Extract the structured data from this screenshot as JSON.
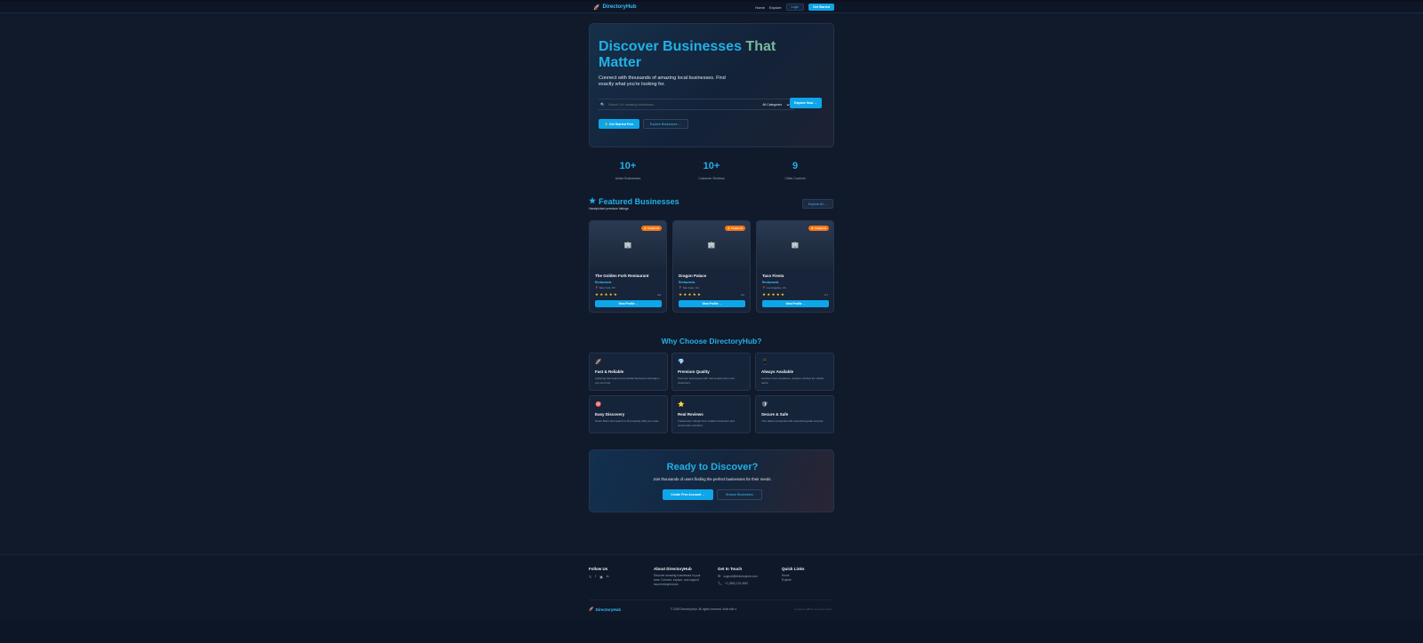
{
  "nav": {
    "logo_text": "DirectoryHub",
    "home": "Home",
    "explore": "Explore",
    "login": "Login",
    "get_started": "Get Started"
  },
  "hero": {
    "title_main": "Discover Businesses ",
    "title_accent": "That",
    "title_end": "Matter",
    "subtitle": "Connect with thousands of amazing local businesses. Find exactly what you're looking for.",
    "search_placeholder": "Search 10+ amazing businesses...",
    "category_selected": "All Categories",
    "explore_now": "Explore Now →",
    "get_started_free": "⚡ Get Started Free",
    "explore_businesses": "Explore Businesses →"
  },
  "stats": [
    {
      "num": "10+",
      "label": "Active Businesses"
    },
    {
      "num": "10+",
      "label": "Customer Reviews"
    },
    {
      "num": "9",
      "label": "Cities Covered"
    }
  ],
  "featured": {
    "title": "Featured Businesses",
    "subtitle": "Handpicked premium listings",
    "explore_all": "Explore All →",
    "cards": [
      {
        "badge": "⭐ Featured",
        "name": "The Golden Fork Restaurant",
        "category": "Restaurants",
        "location": "📍 New York, NY",
        "stars": "★★★★★",
        "rating": "4.8",
        "view": "View Profile →"
      },
      {
        "badge": "⭐ Featured",
        "name": "Dragon Palace",
        "category": "Restaurants",
        "location": "📍 San Jose, CA",
        "stars": "★★★★★",
        "rating": "4.6",
        "view": "View Profile →"
      },
      {
        "badge": "⭐ Featured",
        "name": "Taco Fiesta",
        "category": "Restaurants",
        "location": "📍 Los Angeles, CA",
        "stars": "★★★★★",
        "rating": "4.7",
        "view": "View Profile →"
      }
    ]
  },
  "why": {
    "title": "Why Choose DirectoryHub?",
    "features": [
      {
        "icon": "🚀",
        "title": "Fast & Reliable",
        "desc": "Lightning fast search and verified business information you can trust."
      },
      {
        "icon": "💎",
        "title": "Premium Quality",
        "desc": "Premium businesses with real reviews from real customers."
      },
      {
        "icon": "📱",
        "title": "Always Available",
        "desc": "Access it from anywhere, anytime. Perfect for mobile users."
      },
      {
        "icon": "🎯",
        "title": "Easy Discovery",
        "desc": "Smart filters and search to find exactly what you need."
      },
      {
        "icon": "⭐",
        "title": "Real Reviews",
        "desc": "Transparent ratings from verified customers and community members."
      },
      {
        "icon": "🛡",
        "title": "Secure & Safe",
        "desc": "Your data is protected with enterprise-grade security."
      }
    ]
  },
  "cta": {
    "title": "Ready to Discover?",
    "text": "Join thousands of users finding the perfect businesses for their needs.",
    "create": "Create Free Account →",
    "browse": "Browse Businesses"
  },
  "footer": {
    "follow_title": "Follow Us",
    "social": [
      "𝕏",
      "f",
      "▣",
      "in"
    ],
    "about_title": "About DirectoryHub",
    "about_text": "Discover amazing businesses in your area. Connect, explore, and support local entrepreneurs.",
    "contact_title": "Get In Touch",
    "email": "support@directoryhub.com",
    "phone": "+1 (555) 123-4567",
    "links_title": "Quick Links",
    "link_home": "Home",
    "link_explore": "Explore",
    "logo_text": "DirectoryHub",
    "copyright": "© 2025 DirectoryHub. All rights reserved. Built with",
    "credit_pre": "Crafted by",
    "credit_post": "DirectoryHub Team"
  },
  "colors": {
    "accent": "#0ea5e9",
    "title": "#22b0e8",
    "badge": "#f97316",
    "star": "#facc15",
    "background": "#101a2b"
  }
}
